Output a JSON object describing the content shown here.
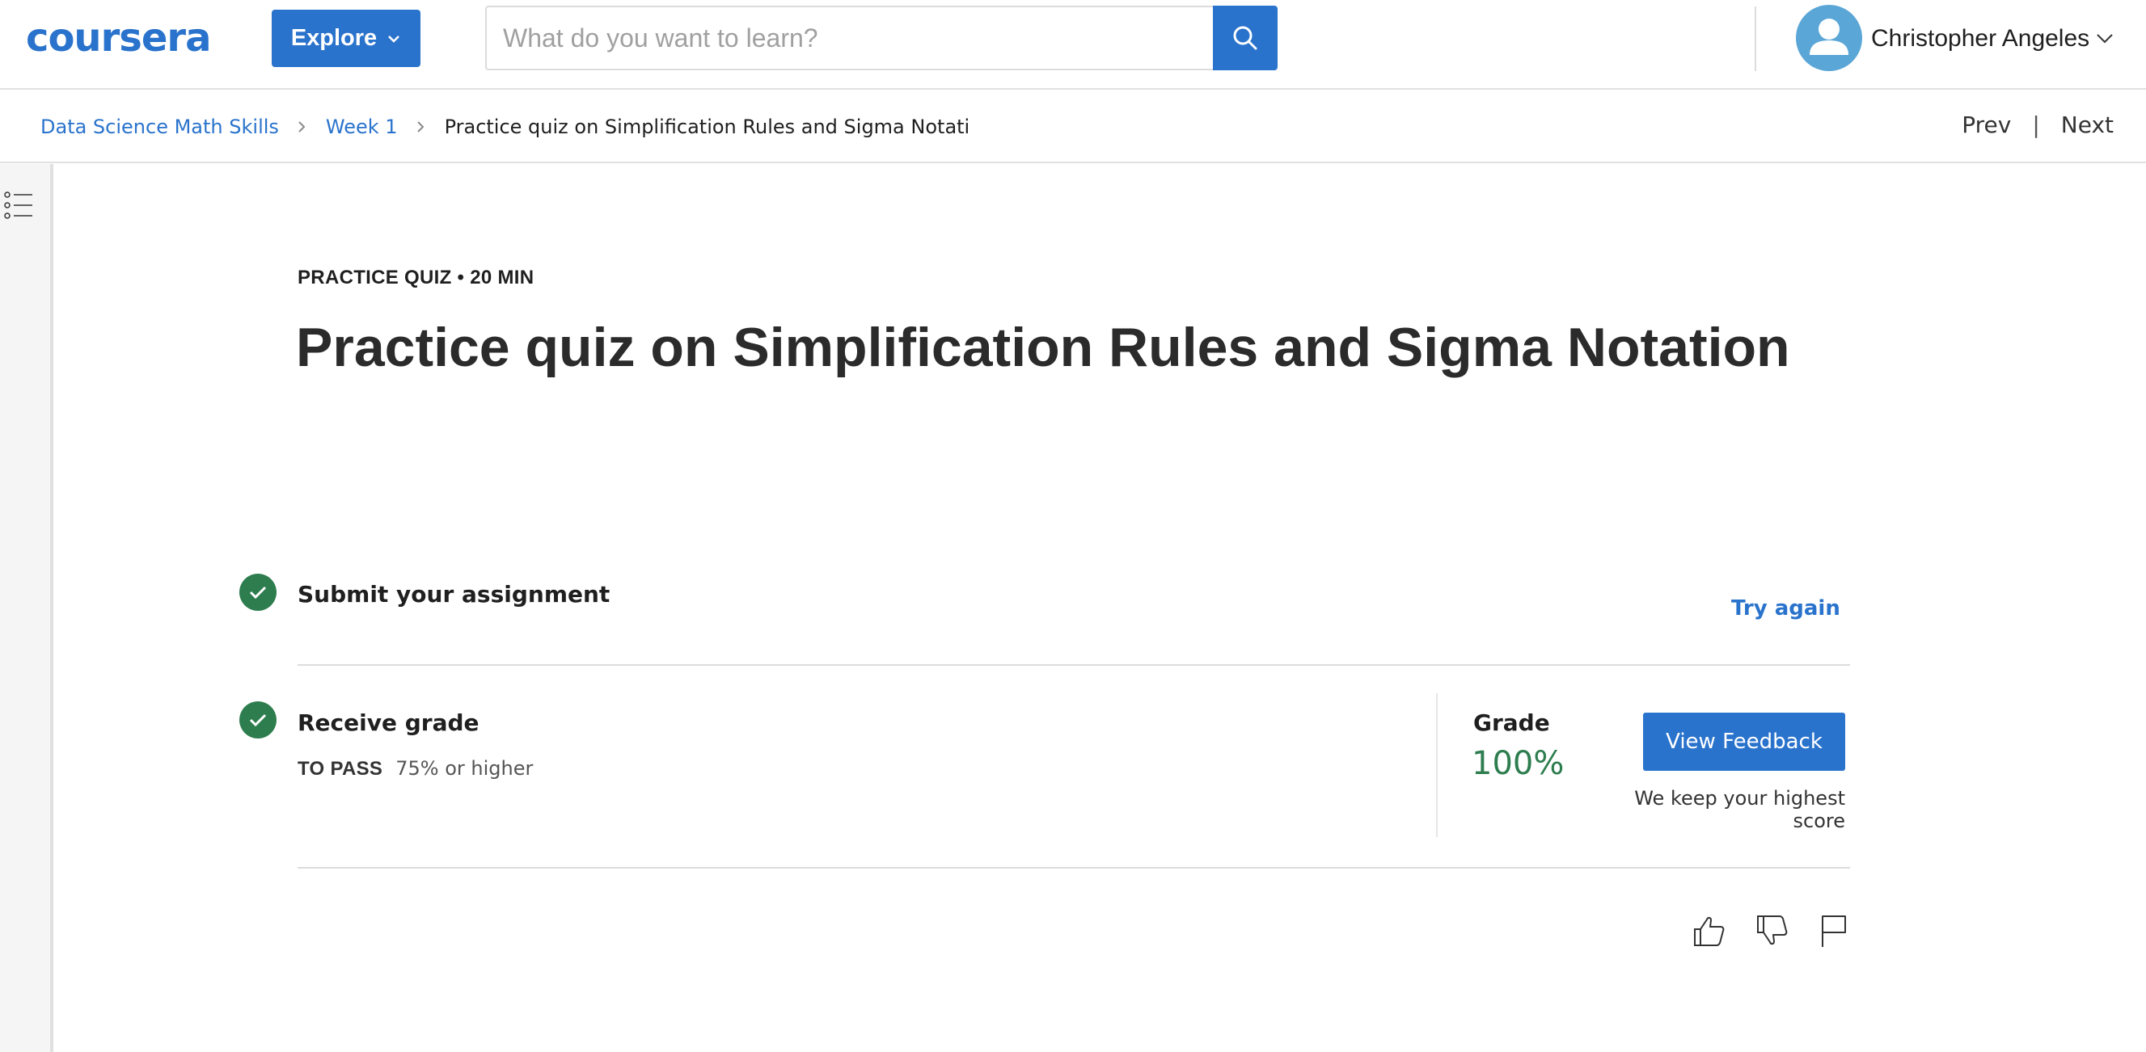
{
  "header": {
    "logo_text": "coursera",
    "explore_label": "Explore",
    "search_placeholder": "What do you want to learn?",
    "user_name": "Christopher Angeles"
  },
  "breadcrumb": {
    "items": [
      "Data Science Math Skills",
      "Week 1"
    ],
    "current": "Practice quiz on Simplification Rules and Sigma Notati",
    "prev_label": "Prev",
    "next_label": "Next",
    "separator": "|"
  },
  "main": {
    "eyebrow": "PRACTICE QUIZ • 20 MIN",
    "title": "Practice quiz on Simplification Rules and Sigma Notation",
    "step1": {
      "title": "Submit your assignment",
      "action": "Try again"
    },
    "step2": {
      "title": "Receive grade",
      "to_pass_label": "TO PASS",
      "to_pass_value": "75% or higher",
      "grade_label": "Grade",
      "grade_value": "100%",
      "feedback_button": "View Feedback",
      "highest_score_note": "We keep your highest score"
    }
  },
  "colors": {
    "brand": "#2a73cc",
    "success": "#2e7d4f"
  }
}
